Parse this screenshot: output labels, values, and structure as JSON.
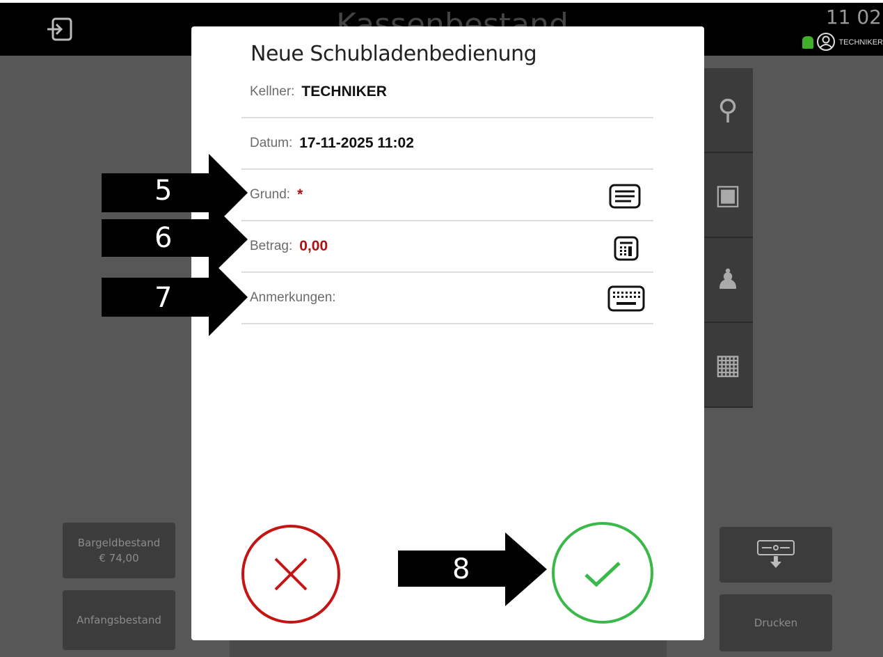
{
  "app": {
    "title": "Kassenbestand",
    "clock": "11 02",
    "user": "TECHNIKER"
  },
  "side_icons": [
    "search-icon",
    "wallet-icon",
    "waiter-icon",
    "calendar-icon"
  ],
  "background": {
    "cash_balance_label": "Bargeldbestand",
    "cash_balance_value": "€ 74,00",
    "initial_balance_label": "Anfangsbestand",
    "print_label": "Drucken"
  },
  "dialog": {
    "title": "Neue Schubladenbedienung",
    "waiter_label": "Kellner:",
    "waiter_value": "TECHNIKER",
    "date_label": "Datum:",
    "date_value": "17-11-2025 11:02",
    "reason_label": "Grund:",
    "reason_required": "*",
    "amount_label": "Betrag:",
    "amount_value": "0,00",
    "notes_label": "Anmerkungen:"
  },
  "annotations": [
    "5",
    "6",
    "7",
    "8"
  ],
  "colors": {
    "cancel": "#c41414",
    "confirm": "#3bb84a",
    "required": "#b01010"
  }
}
